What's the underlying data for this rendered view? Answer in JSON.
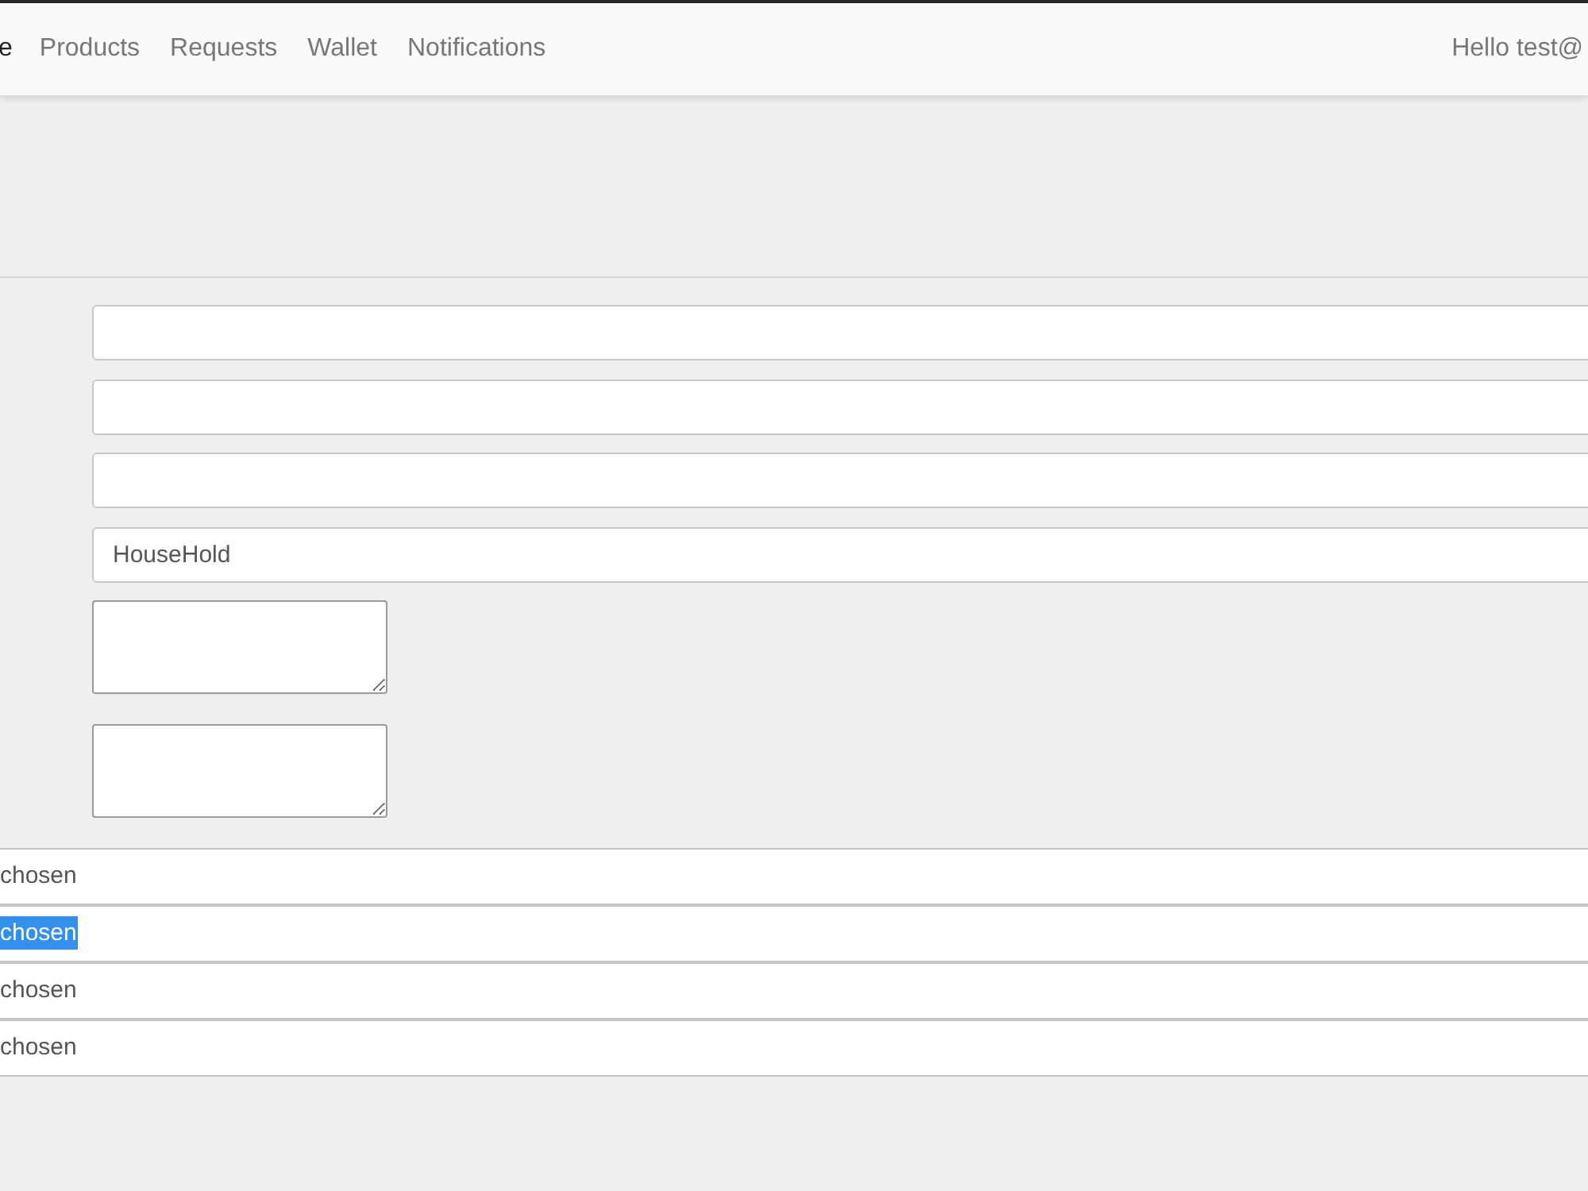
{
  "navbar": {
    "brand": "e",
    "links": [
      {
        "label": "Products"
      },
      {
        "label": "Requests"
      },
      {
        "label": "Wallet"
      },
      {
        "label": "Notifications"
      }
    ],
    "greeting": "Hello test@"
  },
  "form": {
    "fields": [
      {
        "kind": "input"
      },
      {
        "kind": "input"
      },
      {
        "kind": "input"
      },
      {
        "kind": "input",
        "value": "HouseHold"
      },
      {
        "kind": "textarea"
      },
      {
        "kind": "textarea"
      }
    ]
  },
  "file_inputs": [
    {
      "text": "chosen",
      "highlighted": false
    },
    {
      "text": "chosen",
      "highlighted": true
    },
    {
      "text": "chosen",
      "highlighted": false
    },
    {
      "text": "chosen",
      "highlighted": false
    }
  ]
}
